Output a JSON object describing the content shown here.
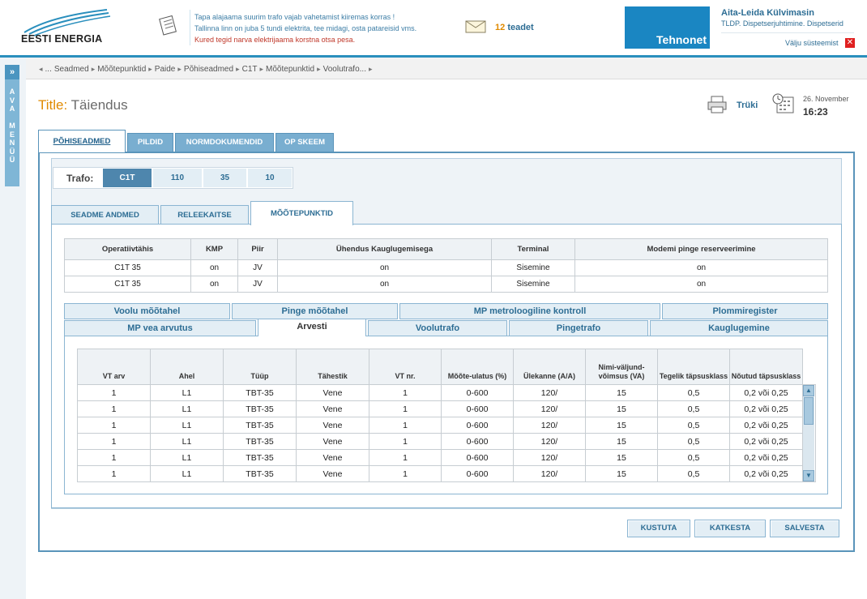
{
  "header": {
    "logo_text": "EESTI ENERGIA",
    "messages": [
      "Tapa alajaama suurim trafo vajab vahetamist kiiremas korras !",
      "Tallinna linn on juba 5 tundi elektrita, tee midagi, osta patareisid vms.",
      "Kured tegid narva elektrijaama korstna otsa pesa."
    ],
    "notices_count": "12",
    "notices_label": "teadet",
    "partner_logo": "Tehnonet",
    "user_name": "Aita-Leida Külvimasin",
    "user_role": "TLDP. Dispetserjuhtimine. Dispetserid",
    "logout_label": "Välju süsteemist"
  },
  "menu": {
    "arrow": "»",
    "label": "AVA MENÜÜ"
  },
  "breadcrumb": [
    "...",
    "Seadmed",
    "Mõõtepunktid",
    "Paide",
    "Põhiseadmed",
    "C1T",
    "Mõõtepunktid",
    "Voolutrafo..."
  ],
  "title": {
    "label": "Title:",
    "value": "Täiendus"
  },
  "print_label": "Trüki",
  "date": "26. November",
  "time": "16:23",
  "main_tabs": [
    "PÕHISEADMED",
    "PILDID",
    "NORMDOKUMENDID",
    "OP SKEEM"
  ],
  "trafo": {
    "label": "Trafo:",
    "options": [
      "C1T",
      "110",
      "35",
      "10"
    ],
    "selected": "C1T"
  },
  "sub_tabs": [
    "SEADME ANDMED",
    "RELEEKAITSE",
    "MÕÕTEPUNKTID"
  ],
  "meter_table": {
    "columns": [
      "Operatiivtähis",
      "KMP",
      "Piir",
      "Ühendus Kauglugemisega",
      "Terminal",
      "Modemi pinge reserveerimine"
    ],
    "rows": [
      [
        "C1T 35",
        "on",
        "JV",
        "on",
        "Sisemine",
        "on"
      ],
      [
        "C1T 35",
        "on",
        "JV",
        "on",
        "Sisemine",
        "on"
      ]
    ]
  },
  "content_tabs": {
    "row1": [
      "Voolu mõõtahel",
      "Pinge mõõtahel",
      "MP metroloogiline kontroll",
      "Plommiregister"
    ],
    "row2": [
      "MP vea arvutus",
      "Arvesti",
      "Voolutrafo",
      "Pingetrafo",
      "Kauglugemine"
    ]
  },
  "vt_table": {
    "columns": [
      "VT arv",
      "Ahel",
      "Tüüp",
      "Tähestik",
      "VT nr.",
      "Mõõte-ulatus (%)",
      "Ülekanne (A/A)",
      "Nimi-väljund-võimsus (VA)",
      "Tegelik täpsusklass",
      "Nõutud täpsusklass"
    ],
    "rows": [
      [
        "1",
        "L1",
        "TBT-35",
        "Vene",
        "1",
        "0-600",
        "120/",
        "15",
        "0,5",
        "0,2 või 0,25"
      ],
      [
        "1",
        "L1",
        "TBT-35",
        "Vene",
        "1",
        "0-600",
        "120/",
        "15",
        "0,5",
        "0,2 või 0,25"
      ],
      [
        "1",
        "L1",
        "TBT-35",
        "Vene",
        "1",
        "0-600",
        "120/",
        "15",
        "0,5",
        "0,2 või 0,25"
      ],
      [
        "1",
        "L1",
        "TBT-35",
        "Vene",
        "1",
        "0-600",
        "120/",
        "15",
        "0,5",
        "0,2 või 0,25"
      ],
      [
        "1",
        "L1",
        "TBT-35",
        "Vene",
        "1",
        "0-600",
        "120/",
        "15",
        "0,5",
        "0,2 või 0,25"
      ],
      [
        "1",
        "L1",
        "TBT-35",
        "Vene",
        "1",
        "0-600",
        "120/",
        "15",
        "0,5",
        "0,2 või 0,25"
      ]
    ]
  },
  "buttons": {
    "delete": "KUSTUTA",
    "cancel": "KATKESTA",
    "save": "SALVESTA"
  }
}
